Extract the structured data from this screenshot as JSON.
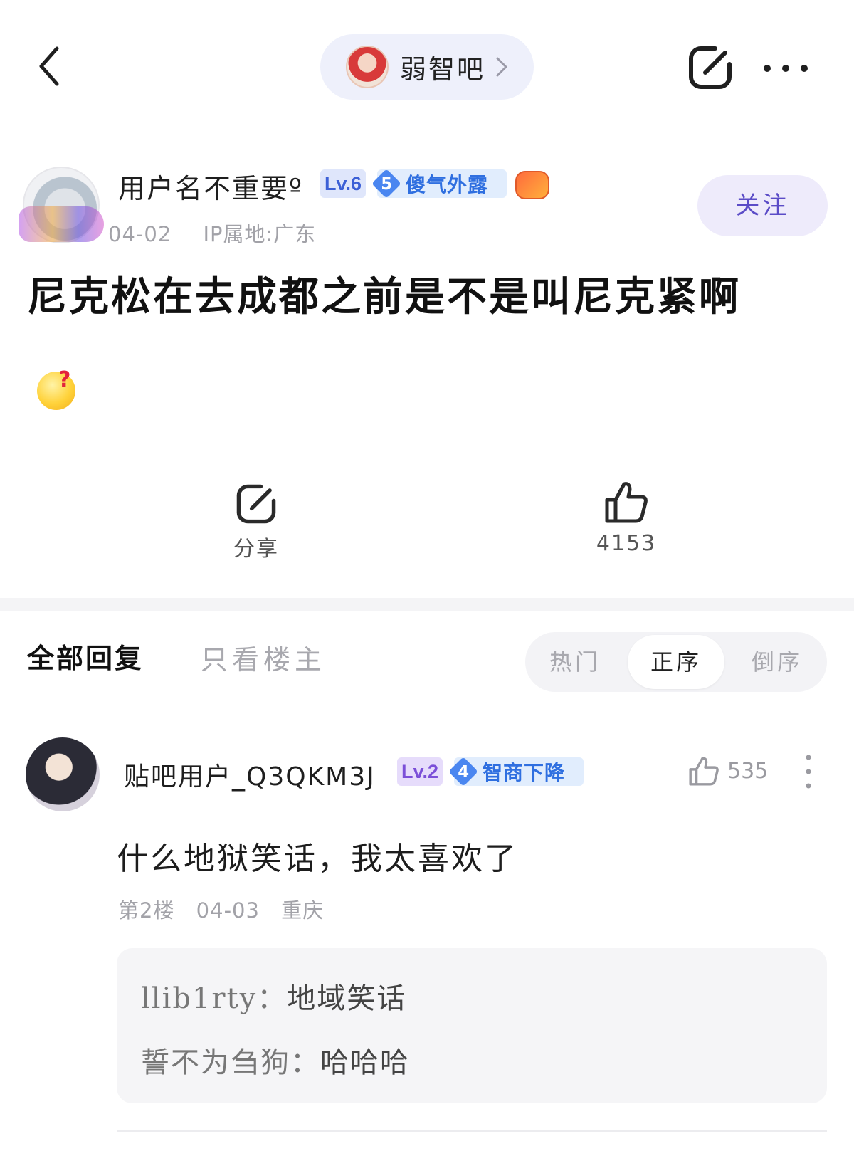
{
  "topbar": {
    "forum_name": "弱智吧"
  },
  "post": {
    "author": {
      "name": "用户名不重要º",
      "level": "Lv.6",
      "title_level": "5",
      "title_text": "傻气外露"
    },
    "date": "04-02",
    "ip": "IP属地:广东",
    "follow_label": "关注",
    "title": "尼克松在去成都之前是不是叫尼克紧啊",
    "share_label": "分享",
    "like_count": "4153"
  },
  "tabs": {
    "all": "全部回复",
    "op_only": "只看楼主",
    "sort": {
      "hot": "热门",
      "asc": "正序",
      "desc": "倒序"
    }
  },
  "comment": {
    "author": {
      "name": "贴吧用户_Q3QKM3J",
      "level": "Lv.2",
      "title_level": "4",
      "title_text": "智商下降"
    },
    "like_count": "535",
    "text": "什么地狱笑话，我太喜欢了",
    "floor": "第2楼",
    "date": "04-03",
    "location": "重庆",
    "replies": [
      {
        "name": "llib1rty：",
        "text": "地域笑话"
      },
      {
        "name": "誓不为刍狗：",
        "text": "哈哈哈"
      }
    ]
  }
}
